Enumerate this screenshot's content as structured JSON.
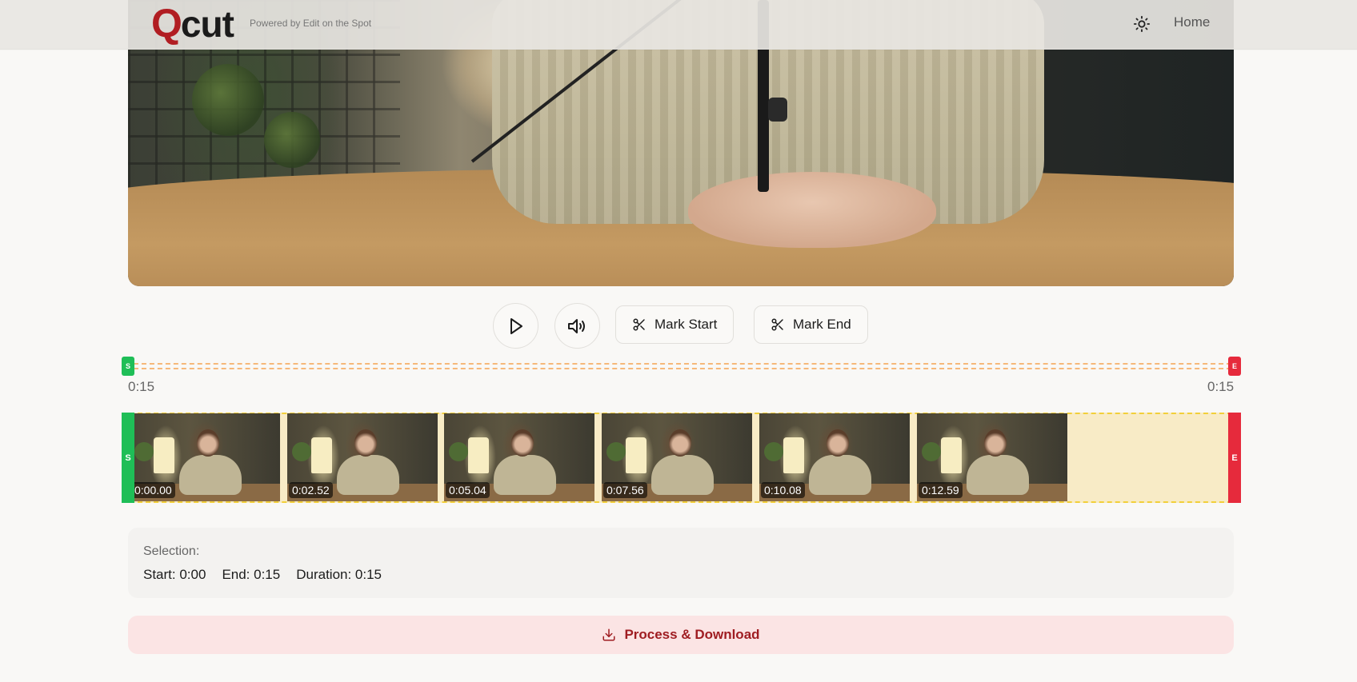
{
  "header": {
    "logo_q": "Q",
    "logo_rest": "cut",
    "tagline": "Powered by Edit on the Spot",
    "home_label": "Home"
  },
  "controls": {
    "mark_start_label": "Mark Start",
    "mark_end_label": "Mark End"
  },
  "range": {
    "start_handle": "S",
    "end_handle": "E",
    "left_time": "0:15",
    "right_time": "0:15"
  },
  "filmstrip": {
    "start_handle": "S",
    "end_handle": "E",
    "frames": [
      "0:00.00",
      "0:02.52",
      "0:05.04",
      "0:07.56",
      "0:10.08",
      "0:12.59"
    ]
  },
  "selection": {
    "title": "Selection:",
    "start": "Start: 0:00",
    "end": "End: 0:15",
    "duration": "Duration: 0:15"
  },
  "process": {
    "label": "Process & Download"
  },
  "colors": {
    "brand": "#b11d22",
    "start_green": "#1fbe57",
    "end_red": "#e62a3c",
    "highlight_yellow": "#f2cf3a"
  }
}
